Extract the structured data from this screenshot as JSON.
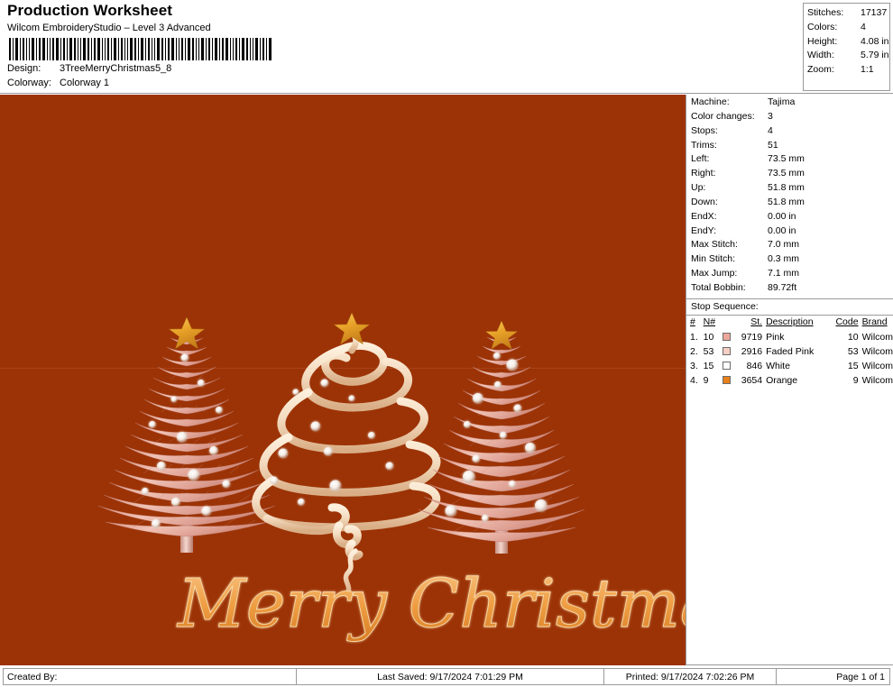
{
  "header": {
    "title": "Production Worksheet",
    "subtitle": "Wilcom EmbroideryStudio – Level 3 Advanced",
    "design_label": "Design:",
    "design_value": "3TreeMerryChristmas5_8",
    "colorway_label": "Colorway:",
    "colorway_value": "Colorway 1",
    "barcode_name": "barcode"
  },
  "summary": [
    {
      "label": "Stitches:",
      "value": "17137"
    },
    {
      "label": "Colors:",
      "value": "4"
    },
    {
      "label": "Height:",
      "value": "4.08 in"
    },
    {
      "label": "Width:",
      "value": "5.79 in"
    },
    {
      "label": "Zoom:",
      "value": "1:1"
    }
  ],
  "stats": [
    {
      "label": "Machine:",
      "value": "Tajima"
    },
    {
      "label": "Color changes:",
      "value": "3"
    },
    {
      "label": "Stops:",
      "value": "4"
    },
    {
      "label": "Trims:",
      "value": "51"
    },
    {
      "label": "Left:",
      "value": "73.5 mm"
    },
    {
      "label": "Right:",
      "value": "73.5 mm"
    },
    {
      "label": "Up:",
      "value": "51.8 mm"
    },
    {
      "label": "Down:",
      "value": "51.8 mm"
    },
    {
      "label": "EndX:",
      "value": "0.00 in"
    },
    {
      "label": "EndY:",
      "value": "0.00 in"
    },
    {
      "label": "Max Stitch:",
      "value": "7.0 mm"
    },
    {
      "label": "Min Stitch:",
      "value": "0.3 mm"
    },
    {
      "label": "Max Jump:",
      "value": "7.1 mm"
    },
    {
      "label": "Total Bobbin:",
      "value": "89.72ft"
    }
  ],
  "stop_sequence": {
    "title": "Stop Sequence:",
    "columns": [
      "#",
      "N#",
      "",
      "St.",
      "Description",
      "Code",
      "Brand"
    ],
    "rows": [
      {
        "idx": "1.",
        "needle": "10",
        "color": "#eda79b",
        "stitches": "9719",
        "description": "Pink",
        "code": "10",
        "brand": "Wilcom"
      },
      {
        "idx": "2.",
        "needle": "53",
        "color": "#f6cfc4",
        "stitches": "2916",
        "description": "Faded Pink",
        "code": "53",
        "brand": "Wilcom"
      },
      {
        "idx": "3.",
        "needle": "15",
        "color": "#ffffff",
        "stitches": "846",
        "description": "White",
        "code": "15",
        "brand": "Wilcom"
      },
      {
        "idx": "4.",
        "needle": "9",
        "color": "#e8801b",
        "stitches": "3654",
        "description": "Orange",
        "code": "9",
        "brand": "Wilcom"
      }
    ]
  },
  "canvas": {
    "background_color": "#9c3306",
    "artwork_name": "three-christmas-trees-merry-christmas",
    "greeting_text": "Merry Christmas",
    "tree_colors": {
      "foliage_pink": "#e8b3a6",
      "foliage_light": "#f7dcd2",
      "star_gold": "#e8a127",
      "swirl_cream": "#f2d7bd",
      "ornament_white": "#ffffff",
      "script_orange": "#f0a24a"
    }
  },
  "footer": {
    "created_by": "Created By:",
    "last_saved": "Last Saved: 9/17/2024 7:01:29 PM",
    "printed": "Printed: 9/17/2024 7:02:26 PM",
    "page": "Page 1 of 1"
  }
}
